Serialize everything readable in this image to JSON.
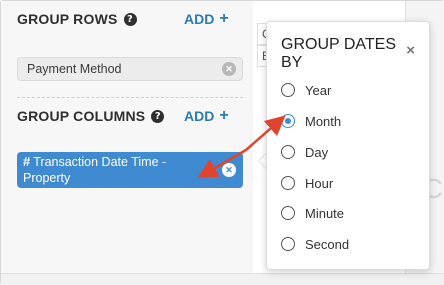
{
  "group_rows": {
    "title": "GROUP ROWS",
    "help_icon": "?",
    "add_label": "ADD",
    "add_icon": "+",
    "items": [
      {
        "label": "Payment Method"
      }
    ]
  },
  "group_columns": {
    "title": "GROUP COLUMNS",
    "help_icon": "?",
    "add_label": "ADD",
    "add_icon": "+",
    "items": [
      {
        "type_icon": "#",
        "label": "Transaction Date Time - Property"
      }
    ]
  },
  "background_table": {
    "cells": [
      "C",
      "E"
    ]
  },
  "popover": {
    "title": "GROUP DATES BY",
    "close_icon": "×",
    "options": [
      {
        "label": "Year",
        "checked": false
      },
      {
        "label": "Month",
        "checked": true
      },
      {
        "label": "Day",
        "checked": false
      },
      {
        "label": "Hour",
        "checked": false
      },
      {
        "label": "Minute",
        "checked": false
      },
      {
        "label": "Second",
        "checked": false
      }
    ]
  },
  "colors": {
    "accent_blue": "#3f8ad0",
    "link_blue": "#2a7ab8",
    "annotation_red": "#e0442e"
  }
}
